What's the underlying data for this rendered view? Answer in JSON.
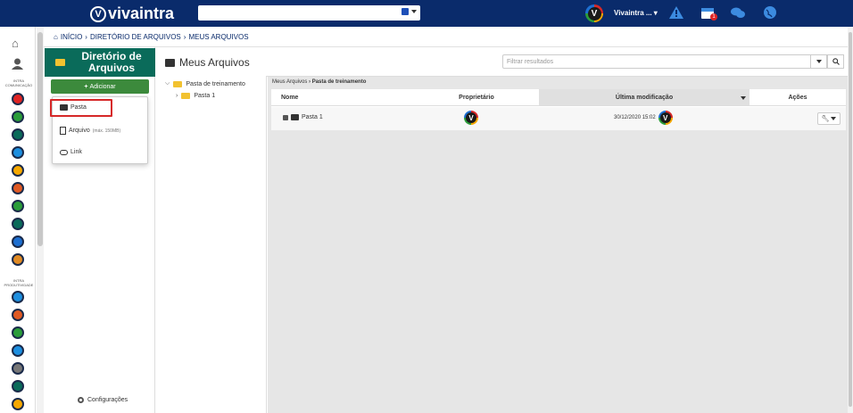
{
  "header": {
    "logo_text": "vivaintra",
    "logo_letter": "V",
    "user_name": "Vivaintra ...",
    "calendar_badge": "1"
  },
  "sidebar": {
    "group1_label": "INTRA COMUNICAÇÃO",
    "group2_label": "INTRA PRODUTIVIDADE",
    "group1_icons": [
      {
        "name": "alert-icon",
        "color": "#e02424"
      },
      {
        "name": "rocket-icon",
        "color": "#2a9d3a"
      },
      {
        "name": "tablet-icon",
        "color": "#0a6b5a"
      },
      {
        "name": "play-icon",
        "color": "#1d8fe0"
      },
      {
        "name": "notes-icon",
        "color": "#f6a800"
      },
      {
        "name": "tree-icon",
        "color": "#e05a24"
      },
      {
        "name": "gallery-icon",
        "color": "#2a9d3a"
      },
      {
        "name": "calendar-icon",
        "color": "#0a6b5a"
      },
      {
        "name": "building-icon",
        "color": "#1d6fd1"
      },
      {
        "name": "board-icon",
        "color": "#e08a24"
      }
    ],
    "group2_icons": [
      {
        "name": "doc-icon",
        "color": "#1d8fe0"
      },
      {
        "name": "clock-icon",
        "color": "#e05a24"
      },
      {
        "name": "tools-icon",
        "color": "#2a9d3a"
      },
      {
        "name": "graduation-icon",
        "color": "#1d8fe0"
      },
      {
        "name": "network-icon",
        "color": "#777777"
      },
      {
        "name": "briefcase-icon",
        "color": "#0a6b5a"
      },
      {
        "name": "folder-icon",
        "color": "#f6a800"
      }
    ]
  },
  "breadcrumb": {
    "home": "INÍCIO",
    "level1": "DIRETÓRIO DE ARQUIVOS",
    "level2": "MEUS ARQUIVOS"
  },
  "directory": {
    "title": "Diretório de Arquivos",
    "add_label": "Adicionar",
    "config_label": "Configurações"
  },
  "dropdown": {
    "folder_label": "Pasta",
    "file_label": "Arquivo",
    "file_hint": "(máx. 150MB)",
    "link_label": "Link"
  },
  "tree": {
    "root": "Pasta de treinamento",
    "child": "Pasta 1"
  },
  "main": {
    "title": "Meus Arquivos",
    "filter_placeholder": "Filtrar resultados",
    "crumb_root": "Meus Arquivos",
    "crumb_current": "Pasta de treinamento"
  },
  "table": {
    "columns": [
      "Nome",
      "Proprietário",
      "Última modificação",
      "Ações"
    ],
    "rows": [
      {
        "name": "Pasta 1",
        "owner_initial": "V",
        "modified": "30/12/2020 15:02",
        "modifier_initial": "V"
      }
    ]
  },
  "colors": {
    "topbar": "#0a2b6b",
    "dir_title": "#0a6b5a",
    "add_button": "#3c8a3c",
    "highlight": "#d62828"
  }
}
